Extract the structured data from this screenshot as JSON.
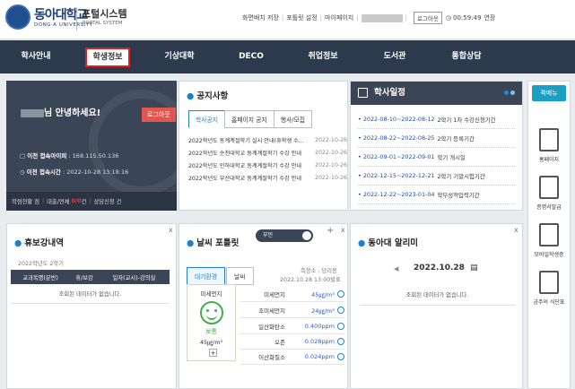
{
  "header": {
    "logo_kor": "동아대학교",
    "logo_eng": "DONG-A UNIVERSITY",
    "portal_kor": "포털시스템",
    "portal_eng": "PORTAL SYSTEM",
    "links": [
      "화면배치 저장",
      "포틀릿 설정",
      "마이페이지"
    ],
    "logout": "로그아웃",
    "timer": "00:59:49",
    "extend": "연장"
  },
  "nav": [
    "학사안내",
    "학생정보",
    "기상대학",
    "DECO",
    "취업정보",
    "도서관",
    "통합상담"
  ],
  "nav_active_index": 1,
  "user": {
    "greeting_suffix": "님 안녕하세요!",
    "logout": "로그아웃",
    "ip_label": "이전 접속아이피",
    "ip_value": "168.115.50.136",
    "time_label": "이전 접속시간",
    "time_value": "2022-10-28 13:18:16",
    "footer": {
      "a": "학점현황",
      "a_val": "점",
      "b": "대출/연체",
      "b_val": "0/0",
      "b_unit": "건",
      "c": "상담신청",
      "c_val": "건"
    }
  },
  "notice": {
    "title": "공지사항",
    "tabs": [
      "학사공지",
      "홈페이지 공지",
      "행사/모집"
    ],
    "items": [
      {
        "text": "2022학년도 동계계절학기 실시 안내(휴학생 수...",
        "date": "2022-10-26"
      },
      {
        "text": "2022학년도 순천대학교 동계계절학기 수강 안내",
        "date": "2022-10-26"
      },
      {
        "text": "2022학년도 인하대학교 동계계절학기 수강 안내",
        "date": "2022-10-26"
      },
      {
        "text": "2022학년도 부산대학교 동계계절학기 수강 안내",
        "date": "2022-10-26"
      }
    ]
  },
  "calendar": {
    "title": "학사일정",
    "items": [
      {
        "date": "2022-08-10~2022-08-12",
        "text": "2학기 1차 수강신청기간"
      },
      {
        "date": "2022-08-22~2022-08-25",
        "text": "2학기 등록기간"
      },
      {
        "date": "2022-09-01~2022-09-01",
        "text": "학기 개시일"
      },
      {
        "date": "2022-12-15~2022-12-21",
        "text": "2학기 기말시험기간"
      },
      {
        "date": "2022-12-22~2023-01-04",
        "text": "학부성적입력기간"
      }
    ]
  },
  "quick": {
    "title": "퀵메뉴",
    "items": [
      "홈페이지",
      "증명서발급",
      "모바일학생증",
      "금주의 식단표"
    ]
  },
  "leave": {
    "title": "휴보강내역",
    "term": "2022학년도 2학기",
    "cols": [
      "교과목명(분반)",
      "휴/보강",
      "일자(교시)-강의실"
    ],
    "empty": "조회된 데이터가 없습니다."
  },
  "weather": {
    "title": "날씨 포틀릿",
    "toggle": "부민",
    "tabs": [
      "대기환경",
      "날씨"
    ],
    "station": "측정소 : 당리동",
    "updated": "2022.10.28 13:00발표",
    "dust_title": "미세먼지",
    "dust_status": "보통",
    "dust_value": "45㎍/m³",
    "rows": [
      {
        "k": "미세먼지",
        "v": "45㎍/m³"
      },
      {
        "k": "초미세먼지",
        "v": "24㎍/m³"
      },
      {
        "k": "일산화탄소",
        "v": "0.400ppm"
      },
      {
        "k": "오존",
        "v": "0.028ppm"
      },
      {
        "k": "이산화질소",
        "v": "0.024ppm"
      }
    ],
    "plus": "+"
  },
  "alert": {
    "title": "동아대 알리미",
    "date": "2022.10.28",
    "empty": "조회된 데이터가 없습니다."
  },
  "close_label": "x"
}
